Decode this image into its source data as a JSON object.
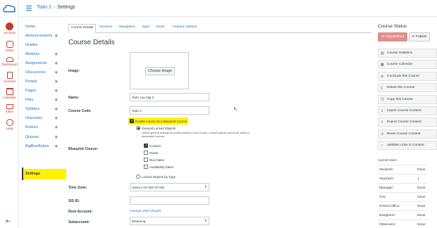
{
  "global_nav": {
    "items": [
      {
        "label": "Account",
        "icon": "account-icon"
      },
      {
        "label": "Admin",
        "icon": "admin-icon"
      },
      {
        "label": "Dashboard",
        "icon": "dashboard-icon"
      },
      {
        "label": "Courses",
        "icon": "courses-icon"
      },
      {
        "label": "Calendar",
        "icon": "calendar-icon"
      },
      {
        "label": "Inbox",
        "icon": "inbox-icon"
      },
      {
        "label": "Help",
        "icon": "help-icon"
      }
    ]
  },
  "header": {
    "course": "Toán 2",
    "separator": "›",
    "page": "Settings"
  },
  "course_nav": {
    "items": [
      "Home",
      "Announcements",
      "Grades",
      "Modules",
      "Assignments",
      "Discussions",
      "People",
      "Pages",
      "Files",
      "Syllabus",
      "Outcomes",
      "Rubrics",
      "Quizzes",
      "BigBlueButton",
      "Settings"
    ],
    "selected": "Settings"
  },
  "tabs": [
    "Course Details",
    "Sections",
    "Navigation",
    "Apps",
    "Alerts",
    "Feature Options"
  ],
  "main": {
    "title": "Course Details",
    "image_label": "Image:",
    "choose_image": "Choose Image",
    "name_label": "Name:",
    "name_value": "Toán cao cấp 2",
    "code_label": "Course Code:",
    "code_value": "Toán 2",
    "blueprint_enable": "Enable course as a Blueprint Course",
    "blueprint_label": "Blueprint Course:",
    "general_locked": "General Locked Objects",
    "general_desc": "Define general settings for locked objects in this course. Locked objects cannot be edited in associated courses.",
    "locked_items": [
      {
        "label": "Content",
        "checked": true
      },
      {
        "label": "Points",
        "checked": false
      },
      {
        "label": "Due Dates",
        "checked": false
      },
      {
        "label": "Availability Dates",
        "checked": false
      }
    ],
    "locked_by_type": "Locked Objects by Type",
    "timezone_label": "Time Zone:",
    "timezone_value": "Hanoi (+07:00/+07:00)",
    "sis_label": "SIS ID:",
    "sis_value": "",
    "root_label": "Root Account:",
    "root_value": "Canvas LMS CloudX",
    "sub_label": "Subaccount:",
    "sub_value": "Elearning"
  },
  "sidebar": {
    "status_title": "Course Status",
    "unpublished": "Unpublished",
    "publish": "Publish",
    "actions": [
      {
        "label": "Course Statistics",
        "icon": "chart-icon"
      },
      {
        "label": "Course Calendar",
        "icon": "calendar-icon"
      },
      {
        "label": "Conclude this Course",
        "icon": "conclude-icon"
      },
      {
        "label": "Delete this Course",
        "icon": "trash-icon"
      },
      {
        "label": "Copy this Course",
        "icon": "copy-icon"
      },
      {
        "label": "Import Course Content",
        "icon": "import-icon"
      },
      {
        "label": "Export Course Content",
        "icon": "export-icon"
      },
      {
        "label": "Reset Course Content",
        "icon": "reset-icon"
      },
      {
        "label": "Validate Links in Content",
        "icon": "validate-icon"
      }
    ],
    "current_users": "Current Users",
    "users": [
      {
        "role": "Students:",
        "count": "None"
      },
      {
        "role": "Teachers:",
        "count": "1"
      },
      {
        "role": "Manager:",
        "count": "None"
      },
      {
        "role": "TAs:",
        "count": "None"
      },
      {
        "role": "School Office:",
        "count": "None"
      },
      {
        "role": "Designers:",
        "count": "None"
      },
      {
        "role": "Observers:",
        "count": "None"
      }
    ]
  },
  "colors": {
    "brand": "#c23c2d",
    "link": "#1c73c4",
    "highlight": "#fff200"
  }
}
